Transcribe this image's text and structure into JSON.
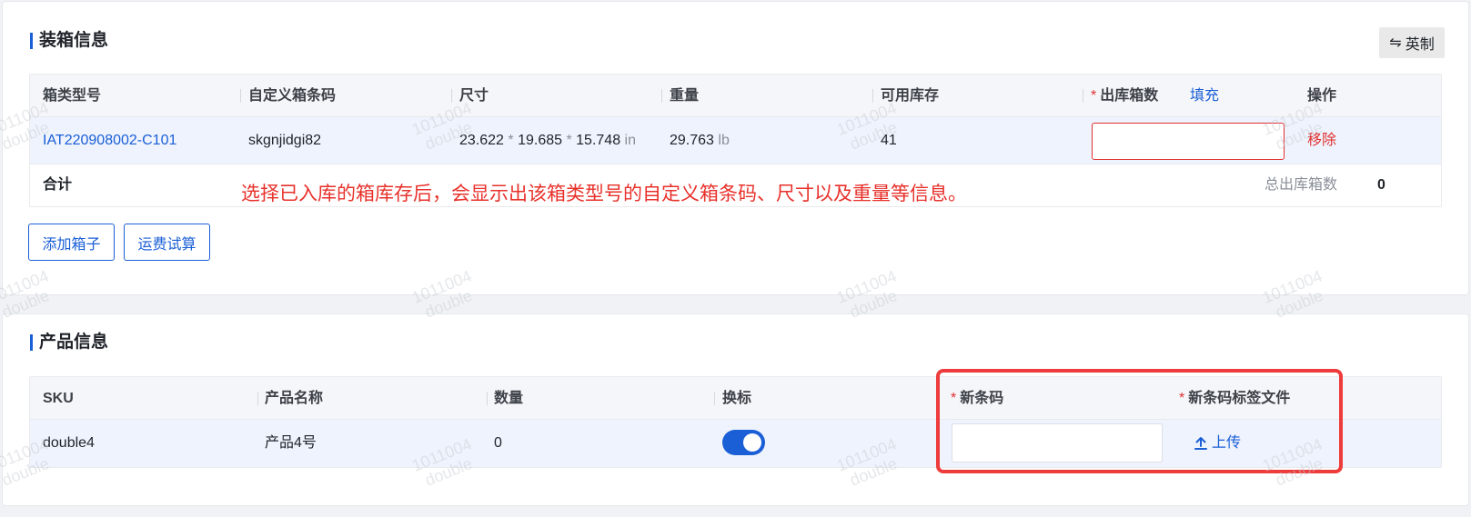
{
  "box_section": {
    "title": "装箱信息",
    "copy_button": "英制",
    "copy_icon": "swap-arrows-icon",
    "columns": {
      "box_type": "箱类型号",
      "custom_code": "自定义箱条码",
      "size": "尺寸",
      "weight": "重量",
      "stock": "可用库存",
      "out_qty": "出库箱数",
      "fill": "填充",
      "action": "操作"
    },
    "row": {
      "box_type": "IAT220908002-C101",
      "custom_code": "skgnjidgi82",
      "dim1": "23.622",
      "dim2": "19.685",
      "dim3": "15.748",
      "times": "*",
      "size_unit": "in",
      "weight": "29.763",
      "weight_unit": "lb",
      "stock": "41",
      "out_qty": "",
      "remove": "移除"
    },
    "sum": {
      "label": "合计",
      "total_label": "总出库箱数",
      "total_value": "0"
    },
    "annotation": "选择已入库的箱库存后，会显示出该箱类型号的自定义箱条码、尺寸以及重量等信息。",
    "buttons": {
      "add_box": "添加箱子",
      "estimate": "运费试算"
    }
  },
  "product_section": {
    "title": "产品信息",
    "columns": {
      "sku": "SKU",
      "name": "产品名称",
      "qty": "数量",
      "relabel": "换标",
      "new_code": "新条码",
      "label_file": "新条码标签文件"
    },
    "row": {
      "sku": "double4",
      "name": "产品4号",
      "qty": "0",
      "relabel_on": true,
      "new_code": "",
      "upload": "上传"
    }
  },
  "required_mark": "*",
  "watermark": {
    "line1": "1011004",
    "line2": "double"
  },
  "colors": {
    "primary": "#1a5fd6",
    "danger": "#e03030",
    "highlight": "#ee3b3b"
  }
}
